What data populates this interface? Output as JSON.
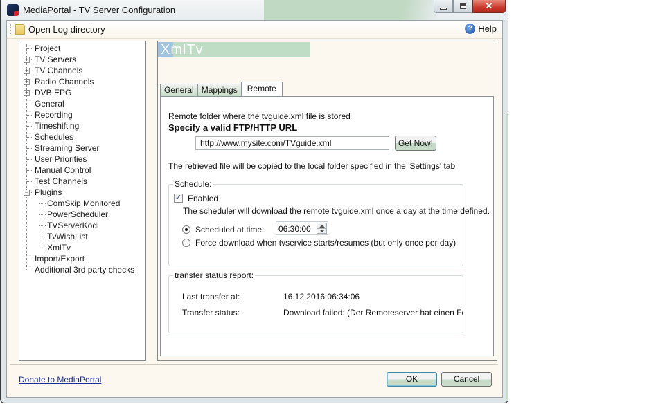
{
  "window": {
    "title": "MediaPortal - TV Server Configuration",
    "controls": {
      "minimize": "minimize",
      "maximize": "maximize",
      "close": "✕"
    }
  },
  "toolbar": {
    "open_log": "Open Log directory",
    "help": "Help",
    "help_glyph": "?"
  },
  "tree": {
    "items": [
      {
        "label": "Project",
        "level": 0,
        "expander": ""
      },
      {
        "label": "TV Servers",
        "level": 0,
        "expander": "+"
      },
      {
        "label": "TV Channels",
        "level": 0,
        "expander": "+"
      },
      {
        "label": "Radio Channels",
        "level": 0,
        "expander": "+"
      },
      {
        "label": "DVB EPG",
        "level": 0,
        "expander": "+"
      },
      {
        "label": "General",
        "level": 0,
        "expander": ""
      },
      {
        "label": "Recording",
        "level": 0,
        "expander": ""
      },
      {
        "label": "Timeshifting",
        "level": 0,
        "expander": ""
      },
      {
        "label": "Schedules",
        "level": 0,
        "expander": ""
      },
      {
        "label": "Streaming Server",
        "level": 0,
        "expander": ""
      },
      {
        "label": "User Priorities",
        "level": 0,
        "expander": ""
      },
      {
        "label": "Manual Control",
        "level": 0,
        "expander": ""
      },
      {
        "label": "Test Channels",
        "level": 0,
        "expander": ""
      },
      {
        "label": "Plugins",
        "level": 0,
        "expander": "−"
      },
      {
        "label": "ComSkip Monitored",
        "level": 1,
        "expander": ""
      },
      {
        "label": "PowerScheduler",
        "level": 1,
        "expander": ""
      },
      {
        "label": "TVServerKodi",
        "level": 1,
        "expander": ""
      },
      {
        "label": "TvWishList",
        "level": 1,
        "expander": ""
      },
      {
        "label": "XmlTv",
        "level": 1,
        "expander": ""
      },
      {
        "label": "Import/Export",
        "level": 0,
        "expander": ""
      },
      {
        "label": "Additional 3rd party checks",
        "level": 0,
        "expander": ""
      }
    ]
  },
  "panel": {
    "title": "XmlTv",
    "tabs": [
      {
        "label": "General",
        "active": false
      },
      {
        "label": "Mappings",
        "active": false
      },
      {
        "label": "Remote",
        "active": true
      }
    ],
    "remote": {
      "folder_label": "Remote folder where the tvguide.xml file is stored",
      "url_heading": "Specify a valid FTP/HTTP URL",
      "url_value": "http://www.mysite.com/TVguide.xml",
      "get_now": "Get Now!",
      "copy_note": "The retrieved file will be copied to the local folder specified in the 'Settings' tab",
      "schedule": {
        "legend": "Schedule:",
        "enabled_label": "Enabled",
        "enabled_checked": true,
        "enabled_check_glyph": "✓",
        "description": "The scheduler will download the remote tvguide.xml once a day at the time defined.",
        "option_scheduled": "Scheduled at time:",
        "option_force": "Force download when tvservice starts/resumes (but only once per day)",
        "selected_option": "scheduled",
        "time_value": "06:30:00"
      },
      "status": {
        "legend": "transfer status report:",
        "last_transfer_label": "Last transfer at:",
        "last_transfer_value": "16.12.2016 06:34:06",
        "transfer_status_label": "Transfer status:",
        "transfer_status_value": "Download failed: (Der Remoteserver hat einen Fehler zu"
      }
    }
  },
  "footer": {
    "donate": "Donate to MediaPortal",
    "ok": "OK",
    "cancel": "Cancel"
  },
  "colors": {
    "accent_green": "#c4dcc6",
    "client_bg": "#fdf8ef",
    "link": "#1b2f9a",
    "close_red": "#c8382a"
  }
}
